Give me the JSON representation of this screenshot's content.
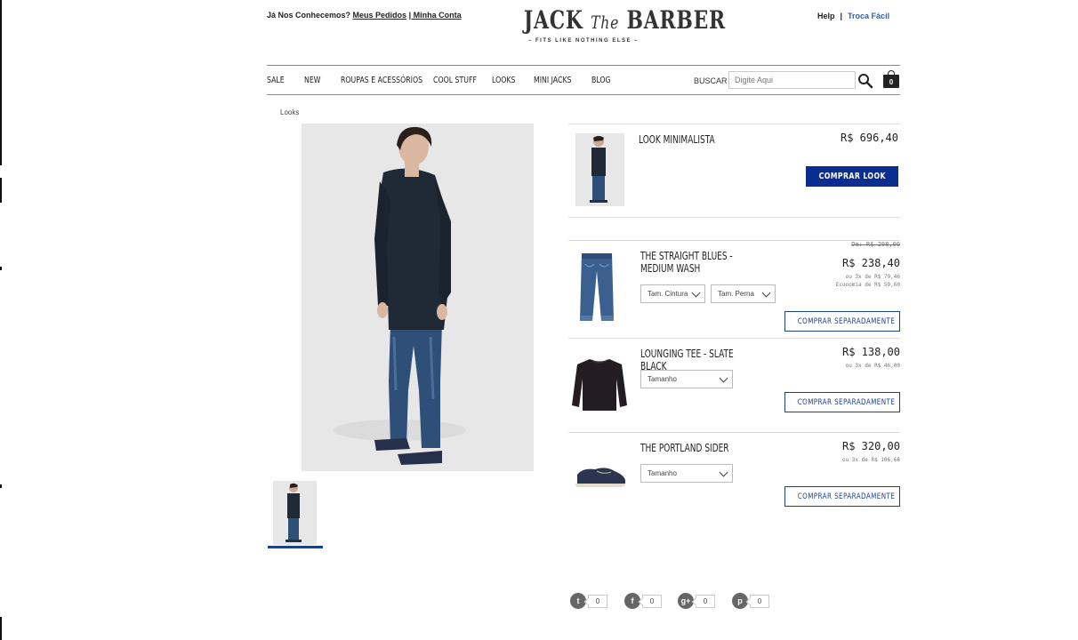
{
  "topbar": {
    "welcome": "Já Nos Conhecemos?",
    "orders_link": "Meus Pedidos",
    "account_link": "| Minha Conta",
    "help_link": "Help",
    "separator": "|",
    "exchange_link": "Troca Fácil"
  },
  "logo": {
    "name_left": "JACK",
    "name_mid": "The",
    "name_right": "BARBER",
    "tagline": "– FITS LIKE NOTHING ELSE –"
  },
  "nav": {
    "items": [
      "SALE",
      "NEW",
      "ROUPAS E ACESSÓRIOS",
      "COOL STUFF",
      "LOOKS",
      "MINI JACKS",
      "BLOG"
    ],
    "search_label": "BUSCAR",
    "search_placeholder": "Digite Aqui",
    "cart_count": "0"
  },
  "breadcrumb": "Looks",
  "look": {
    "title": "LOOK MINIMALISTA",
    "price": "R$ 696,40",
    "buy_button": "COMPRAR LOOK"
  },
  "products": [
    {
      "title": "THE STRAIGHT BLUES - MEDIUM WASH",
      "old_price": "De: R$ 298,00",
      "price": "R$ 238,40",
      "installments": "ou 3x de R$ 79,46",
      "savings": "Economia de R$ 59,60",
      "selects": [
        "Tam. Cintura",
        "Tam. Perna"
      ],
      "button": "COMPRAR SEPARADAMENTE"
    },
    {
      "title": "LOUNGING TEE - SLATE BLACK",
      "price": "R$ 138,00",
      "installments": "ou 3x de R$ 46,00",
      "selects": [
        "Tamanho"
      ],
      "button": "COMPRAR SEPARADAMENTE"
    },
    {
      "title": "THE PORTLAND SIDER",
      "price": "R$ 320,00",
      "installments": "ou 3x de R$ 106,66",
      "selects": [
        "Tamanho"
      ],
      "button": "COMPRAR SEPARADAMENTE"
    }
  ],
  "social": [
    {
      "icon": "twitter-icon",
      "glyph": "t",
      "count": "0"
    },
    {
      "icon": "facebook-icon",
      "glyph": "f",
      "count": "0"
    },
    {
      "icon": "google-plus-icon",
      "glyph": "g+",
      "count": "0"
    },
    {
      "icon": "pinterest-icon",
      "glyph": "p",
      "count": "0"
    }
  ],
  "colors": {
    "primary_blue": "#0b2d8f",
    "link_blue": "#3a5f9c",
    "photo_bg": "#e8e7e8"
  }
}
